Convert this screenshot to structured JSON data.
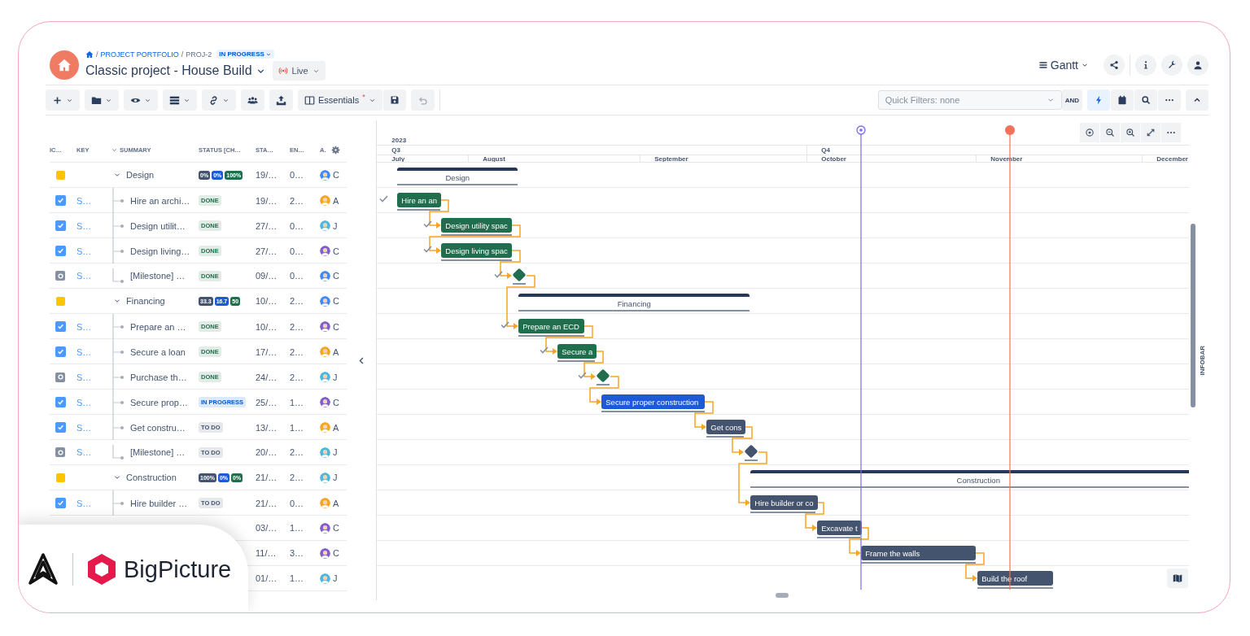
{
  "breadcrumb": {
    "items": [
      {
        "text": "/",
        "kind": "separator"
      },
      {
        "text": "PROJECT PORTFOLIO",
        "kind": "link"
      },
      {
        "text": "/",
        "kind": "separator"
      },
      {
        "text": "PROJ-2",
        "kind": "plain"
      }
    ],
    "status": "IN PROGRESS"
  },
  "title": "Classic project - House Build",
  "live_button": "Live",
  "view_switcher": "Gantt",
  "toolbar": {
    "essentials": {
      "label": "Essentials",
      "modified_mark": "*"
    },
    "undo": {
      "disabled": true
    },
    "quick_filter": {
      "placeholder": "Quick Filters: none"
    },
    "and_label": "AND",
    "right_tools": [
      {
        "selected": true
      },
      {
        "selected": false
      },
      {
        "selected": false
      },
      {
        "selected": false
      }
    ]
  },
  "table": {
    "columns": [
      "IC…",
      "KEY",
      "SUMMARY",
      "STATUS [CH…",
      "STA…",
      "EN…",
      "A."
    ],
    "rows": [
      {
        "kind": "group",
        "expanded": true,
        "summary": "Design",
        "progress": [
          "0%",
          "0%",
          "100%"
        ],
        "start": "19/…",
        "end": "0…",
        "avatar": {
          "initial": "C",
          "color": "#3d8bfd"
        },
        "bar": {
          "label": "Design"
        }
      },
      {
        "kind": "task",
        "key": "S…",
        "summary": "Hire an archi…",
        "status": {
          "text": "DONE",
          "color": "#216e4e"
        },
        "start": "19/…",
        "end": "2…",
        "avatar": {
          "initial": "A",
          "color": "#f5a623"
        },
        "bar": {
          "label": "Hire an an",
          "color": "#216e4e",
          "done": true
        }
      },
      {
        "kind": "task",
        "key": "S…",
        "summary": "Design utilit…",
        "status": {
          "text": "DONE",
          "color": "#216e4e"
        },
        "start": "27/…",
        "end": "0…",
        "avatar": {
          "initial": "J",
          "color": "#4bb8e0"
        },
        "bar": {
          "label": "Design utility spac",
          "color": "#216e4e",
          "done": true
        }
      },
      {
        "kind": "task",
        "key": "S…",
        "summary": "Design living…",
        "status": {
          "text": "DONE",
          "color": "#216e4e"
        },
        "start": "27/…",
        "end": "0…",
        "avatar": {
          "initial": "C",
          "color": "#7f5fd1"
        },
        "bar": {
          "label": "Design living spac",
          "color": "#216e4e",
          "done": true
        }
      },
      {
        "kind": "milestone",
        "key": "S…",
        "summary": "[Milestone] …",
        "status": {
          "text": "DONE",
          "color": "#216e4e"
        },
        "start": "09/…",
        "end": "0…",
        "avatar": {
          "initial": "C",
          "color": "#3d8bfd"
        },
        "bar": {
          "color": "#216e4e",
          "done": true
        }
      },
      {
        "kind": "group",
        "expanded": true,
        "summary": "Financing",
        "progress": [
          "33.3",
          "16.7",
          "50"
        ],
        "start": "10/…",
        "end": "2…",
        "avatar": {
          "initial": "C",
          "color": "#3d8bfd"
        },
        "bar": {
          "label": "Financing"
        }
      },
      {
        "kind": "task",
        "key": "S…",
        "summary": "Prepare an …",
        "status": {
          "text": "DONE",
          "color": "#216e4e"
        },
        "start": "10/…",
        "end": "2…",
        "avatar": {
          "initial": "C",
          "color": "#7f5fd1"
        },
        "bar": {
          "label": "Prepare an ECD",
          "color": "#216e4e",
          "done": true
        }
      },
      {
        "kind": "task",
        "key": "S…",
        "summary": "Secure a loan",
        "status": {
          "text": "DONE",
          "color": "#216e4e"
        },
        "start": "17/…",
        "end": "2…",
        "avatar": {
          "initial": "A",
          "color": "#f5a623"
        },
        "bar": {
          "label": "Secure a",
          "color": "#216e4e",
          "done": true
        }
      },
      {
        "kind": "milestone",
        "key": "S…",
        "summary": "Purchase th…",
        "status": {
          "text": "DONE",
          "color": "#216e4e"
        },
        "start": "24/…",
        "end": "2…",
        "avatar": {
          "initial": "J",
          "color": "#4bb8e0"
        },
        "bar": {
          "color": "#216e4e",
          "done": true
        }
      },
      {
        "kind": "task",
        "key": "S…",
        "summary": "Secure prop…",
        "status": {
          "text": "IN PROGRESS",
          "color": "#0055cc"
        },
        "start": "25/…",
        "end": "1…",
        "avatar": {
          "initial": "C",
          "color": "#7f5fd1"
        },
        "bar": {
          "label": "Secure proper construction",
          "color": "#1d5bd6",
          "done": false
        }
      },
      {
        "kind": "task",
        "key": "S…",
        "summary": "Get constru…",
        "status": {
          "text": "TO DO",
          "color": "#44546f"
        },
        "start": "13/…",
        "end": "1…",
        "avatar": {
          "initial": "A",
          "color": "#f5a623"
        },
        "bar": {
          "label": "Get cons",
          "color": "#44546f",
          "done": false
        }
      },
      {
        "kind": "milestone",
        "key": "S…",
        "summary": "[Milestone] …",
        "status": {
          "text": "TO DO",
          "color": "#44546f"
        },
        "start": "20/…",
        "end": "2…",
        "avatar": {
          "initial": "J",
          "color": "#4bb8e0"
        },
        "bar": {
          "color": "#44546f",
          "done": false
        }
      },
      {
        "kind": "group",
        "expanded": true,
        "summary": "Construction",
        "progress": [
          "100%",
          "0%",
          "0%"
        ],
        "start": "21/…",
        "end": "2…",
        "avatar": {
          "initial": "J",
          "color": "#4bb8e0"
        },
        "bar": {
          "label": "Construction"
        }
      },
      {
        "kind": "task",
        "key": "S…",
        "summary": "Hire builder …",
        "status": {
          "text": "TO DO",
          "color": "#44546f"
        },
        "start": "21/…",
        "end": "0…",
        "avatar": {
          "initial": "A",
          "color": "#f5a623"
        },
        "bar": {
          "label": "Hire builder or co",
          "color": "#44546f",
          "done": false
        }
      },
      {
        "kind": "task",
        "start": "03/…",
        "end": "1…",
        "avatar": {
          "initial": "C",
          "color": "#7f5fd1"
        },
        "bar": {
          "label": "Excavate t",
          "color": "#44546f",
          "done": false
        }
      },
      {
        "kind": "task",
        "start": "11/…",
        "end": "3…",
        "avatar": {
          "initial": "C",
          "color": "#7f5fd1"
        },
        "bar": {
          "label": "Frame the walls",
          "color": "#44546f",
          "done": false
        }
      },
      {
        "kind": "task",
        "start": "01/…",
        "end": "1…",
        "avatar": {
          "initial": "J",
          "color": "#4bb8e0"
        },
        "bar": {
          "label": "Build the roof",
          "color": "#44546f",
          "done": false
        }
      }
    ]
  },
  "timeline": {
    "year": "2023",
    "quarters": [
      "Q3",
      "Q4"
    ],
    "months": [
      "July",
      "August",
      "September",
      "October",
      "November",
      "December"
    ]
  },
  "infobar": "INFOBAR",
  "brand_badge": {
    "name": "BigPicture"
  }
}
